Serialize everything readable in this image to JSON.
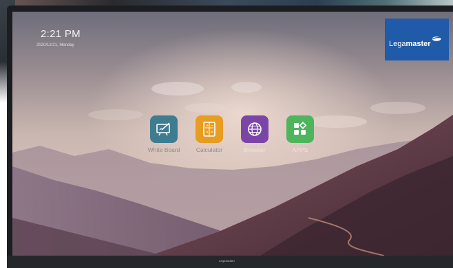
{
  "status": {
    "time": "2:21 PM",
    "date": "2020/12/21, Monday"
  },
  "brand": {
    "name_light": "Lega",
    "name_bold": "master",
    "chin_logo": "Legamaster",
    "logo_icon": "legamaster-swoosh-icon",
    "background_color": "#1f5ba8"
  },
  "apps": [
    {
      "label": "White Board",
      "icon": "whiteboard-icon",
      "color": "#3e7c90"
    },
    {
      "label": "Calculator",
      "icon": "calculator-icon",
      "color": "#e79c22"
    },
    {
      "label": "Browser",
      "icon": "globe-icon",
      "color": "#7b45a7"
    },
    {
      "label": "APPS",
      "icon": "apps-grid-icon",
      "color": "#4fb55d"
    }
  ]
}
